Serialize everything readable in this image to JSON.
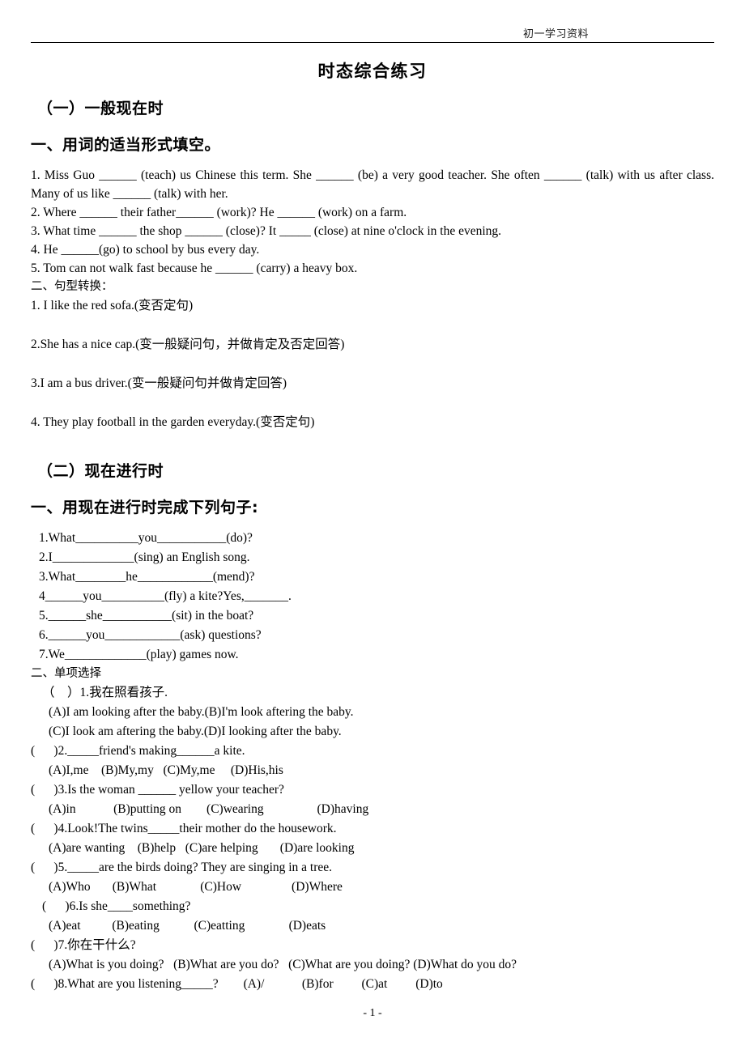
{
  "header": {
    "running_title": "初一学习资料"
  },
  "title": "时态综合练习",
  "section1": {
    "heading": "（一）一般现在时",
    "part1_heading": "一、用词的适当形式填空。",
    "fill_items": [
      "1. Miss Guo ______ (teach) us Chinese this term. She ______ (be) a very good teacher. She often ______ (talk) with us after class. Many of us like ______ (talk) with her.",
      "2. Where ______ their father______ (work)? He ______ (work) on a farm.",
      "3. What time ______ the shop ______ (close)? It _____ (close) at nine o'clock in the evening.",
      "4. He ______(go) to school by bus every day.",
      "5. Tom can not walk fast because he ______ (carry) a heavy box."
    ],
    "part2_heading": "二、句型转换：",
    "transform_items": [
      "1. I like the red sofa.(变否定句)",
      "2.She has a nice cap.(变一般疑问句，并做肯定及否定回答)",
      "3.I am a bus driver.(变一般疑问句并做肯定回答)",
      "4. They play football in the garden everyday.(变否定句)"
    ]
  },
  "section2": {
    "heading": "（二）现在进行时",
    "part1_heading": "一、用现在进行时完成下列句子:",
    "fill_items": [
      "1.What__________you___________(do)?",
      "2.I_____________(sing) an English song.",
      "3.What________he____________(mend)?",
      "4______you__________(fly) a kite?Yes,_______.",
      "5.______she___________(sit) in the boat?",
      "6.______you____________(ask) questions?",
      "7.We_____________(play) games now."
    ],
    "part2_heading": "二、单项选择",
    "mc_items": [
      {
        "stem": "（    ）1.我在照看孩子.",
        "options": [
          "(A)I am looking after the baby.(B)I'm look aftering the baby.",
          "(C)I look am aftering the baby.(D)I looking after the baby."
        ]
      },
      {
        "stem": "(      )2._____friend's making______a kite.",
        "options": [
          "(A)I,me    (B)My,my   (C)My,me     (D)His,his"
        ]
      },
      {
        "stem": "(      )3.Is the woman ______ yellow your teacher?",
        "options": [
          "(A)in            (B)putting on        (C)wearing                 (D)having"
        ]
      },
      {
        "stem": "(      )4.Look!The twins_____their mother do the housework.",
        "options": [
          "(A)are wanting    (B)help   (C)are helping       (D)are looking"
        ]
      },
      {
        "stem": "(      )5._____are the birds doing? They are singing in a tree.",
        "options": [
          "(A)Who       (B)What              (C)How                (D)Where"
        ]
      },
      {
        "stem": "(      )6.Is she____something?",
        "options": [
          "(A)eat          (B)eating           (C)eatting              (D)eats"
        ]
      },
      {
        "stem": "(      )7.你在干什么?",
        "options": [
          "(A)What is you doing?   (B)What are you do?   (C)What are you doing? (D)What do you do?"
        ]
      },
      {
        "stem": "(      )8.What are you listening_____?        (A)/            (B)for         (C)at         (D)to",
        "options": []
      }
    ]
  },
  "footer": {
    "page_number": "- 1 -"
  }
}
